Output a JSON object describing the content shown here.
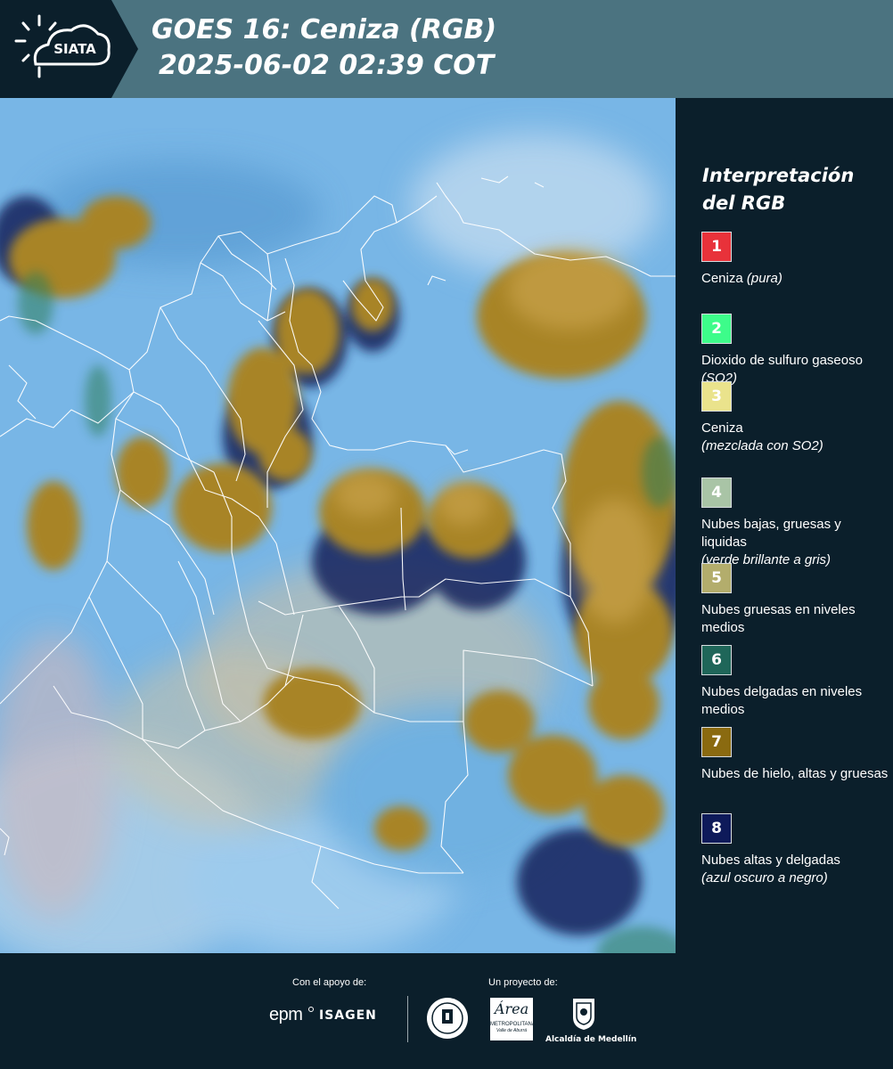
{
  "header": {
    "logo_text": "SIATA",
    "title": "GOES 16: Ceniza (RGB)",
    "timestamp": "2025-06-02 02:39 COT"
  },
  "legend": {
    "title_line1": "Interpretación",
    "title_line2": "del RGB",
    "items": [
      {
        "number": "1",
        "color": "#e8323a",
        "text_color": "#ffffff",
        "label": "Ceniza ",
        "detail": "(pura)"
      },
      {
        "number": "2",
        "color": "#3dfc8a",
        "text_color": "#ffffff",
        "label": "Dioxido de sulfuro gaseoso ",
        "detail": "(SO2)"
      },
      {
        "number": "3",
        "color": "#eae38c",
        "text_color": "#ffffff",
        "label": "Ceniza",
        "detail": "(mezclada con SO2)"
      },
      {
        "number": "4",
        "color": "#a9c4a6",
        "text_color": "#ffffff",
        "label": "Nubes bajas, gruesas y liquidas",
        "detail": "(verde brillante a gris)"
      },
      {
        "number": "5",
        "color": "#b3ad6c",
        "text_color": "#ffffff",
        "label": "Nubes gruesas en niveles medios",
        "detail": ""
      },
      {
        "number": "6",
        "color": "#1f6659",
        "text_color": "#ffffff",
        "label": "Nubes delgadas en niveles medios",
        "detail": ""
      },
      {
        "number": "7",
        "color": "#8a6a10",
        "text_color": "#ffffff",
        "label": "Nubes de hielo, altas y gruesas",
        "detail": ""
      },
      {
        "number": "8",
        "color": "#0e1a5a",
        "text_color": "#ffffff",
        "label": "Nubes altas y delgadas",
        "detail": "(azul oscuro a negro)"
      }
    ]
  },
  "footer": {
    "support_label": "Con el apoyo de:",
    "project_label": "Un proyecto de:",
    "epm": "epm",
    "isagen": "ISAGEN",
    "area_text": "Área",
    "area_sub": "METROPOLITANA",
    "area_sub2": "Valle de Aburrá",
    "alcaldia": "Alcaldía de Medellín"
  },
  "colors": {
    "header_bg": "#4b7380",
    "page_bg": "#0b1f2b",
    "ocean": "#78b6e6",
    "land": "#6fa9dc",
    "cloud_ice": "#b08a2a",
    "high_thin": "#13235e",
    "border_lines": "#ffffff"
  }
}
